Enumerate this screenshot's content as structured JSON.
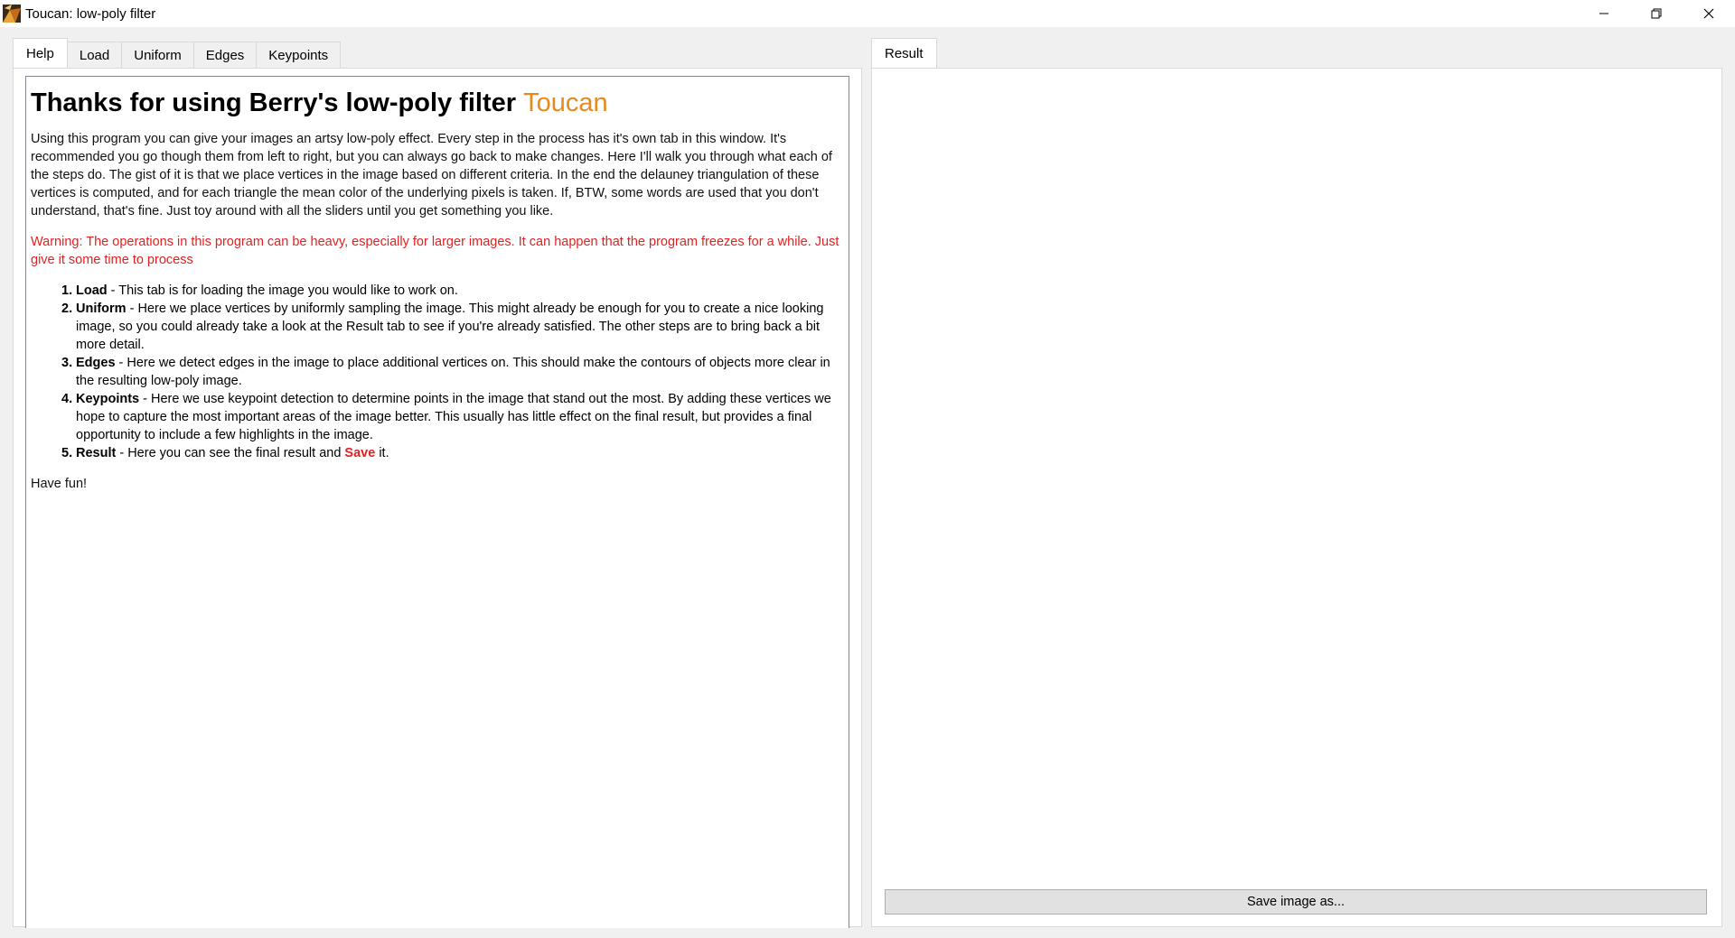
{
  "window": {
    "title": "Toucan: low-poly filter",
    "icon": "toucan-app-icon"
  },
  "left_tabs": [
    {
      "label": "Help",
      "active": true
    },
    {
      "label": "Load",
      "active": false
    },
    {
      "label": "Uniform",
      "active": false
    },
    {
      "label": "Edges",
      "active": false
    },
    {
      "label": "Keypoints",
      "active": false
    }
  ],
  "help": {
    "title_main": "Thanks for using Berry's low-poly filter ",
    "title_accent": "Toucan",
    "intro": "Using this program you can give your images an artsy low-poly effect. Every step in the process has it's own tab in this window. It's recommended you go though them from left to right, but you can always go back to make changes. Here I'll walk you through what each of the steps do. The gist of it is that we place vertices in the image based on different criteria. In the end the delauney triangulation of these vertices is computed, and for each triangle the mean color of the underlying pixels is taken. If, BTW, some words are used that you don't understand, that's fine. Just toy around with all the sliders until you get something you like.",
    "warning": "Warning: The operations in this program can be heavy, especially for larger images. It can happen that the program freezes for a while. Just give it some time to process",
    "steps": [
      {
        "num": "1.",
        "name": "Load",
        "text": " - This tab is for loading the image you would like to work on."
      },
      {
        "num": "2.",
        "name": "Uniform",
        "text": " - Here we place vertices by uniformly sampling the image. This might already be enough for you to create a nice looking image, so you could already take a look at the Result tab to see if you're already satisfied. The other steps are to bring back a bit more detail."
      },
      {
        "num": "3.",
        "name": "Edges",
        "text": " - Here we detect edges in the image to place additional vertices on. This should make the contours of objects more clear in the resulting low-poly image."
      },
      {
        "num": "4.",
        "name": "Keypoints",
        "text": " - Here we use keypoint detection to determine points in the image that stand out the most. By adding these vertices we hope to capture the most important areas of the image better. This usually has little effect on the final result, but provides a final opportunity to include a few highlights in the image."
      },
      {
        "num": "5.",
        "name": "Result",
        "text_before": " - Here you can see the final result and ",
        "save_word": "Save",
        "text_after": " it."
      }
    ],
    "outro": "Have fun!"
  },
  "right_tabs": [
    {
      "label": "Result",
      "active": true
    }
  ],
  "save_button": "Save image as...",
  "colors": {
    "accent": "#e68a1f",
    "warning": "#e52020"
  }
}
